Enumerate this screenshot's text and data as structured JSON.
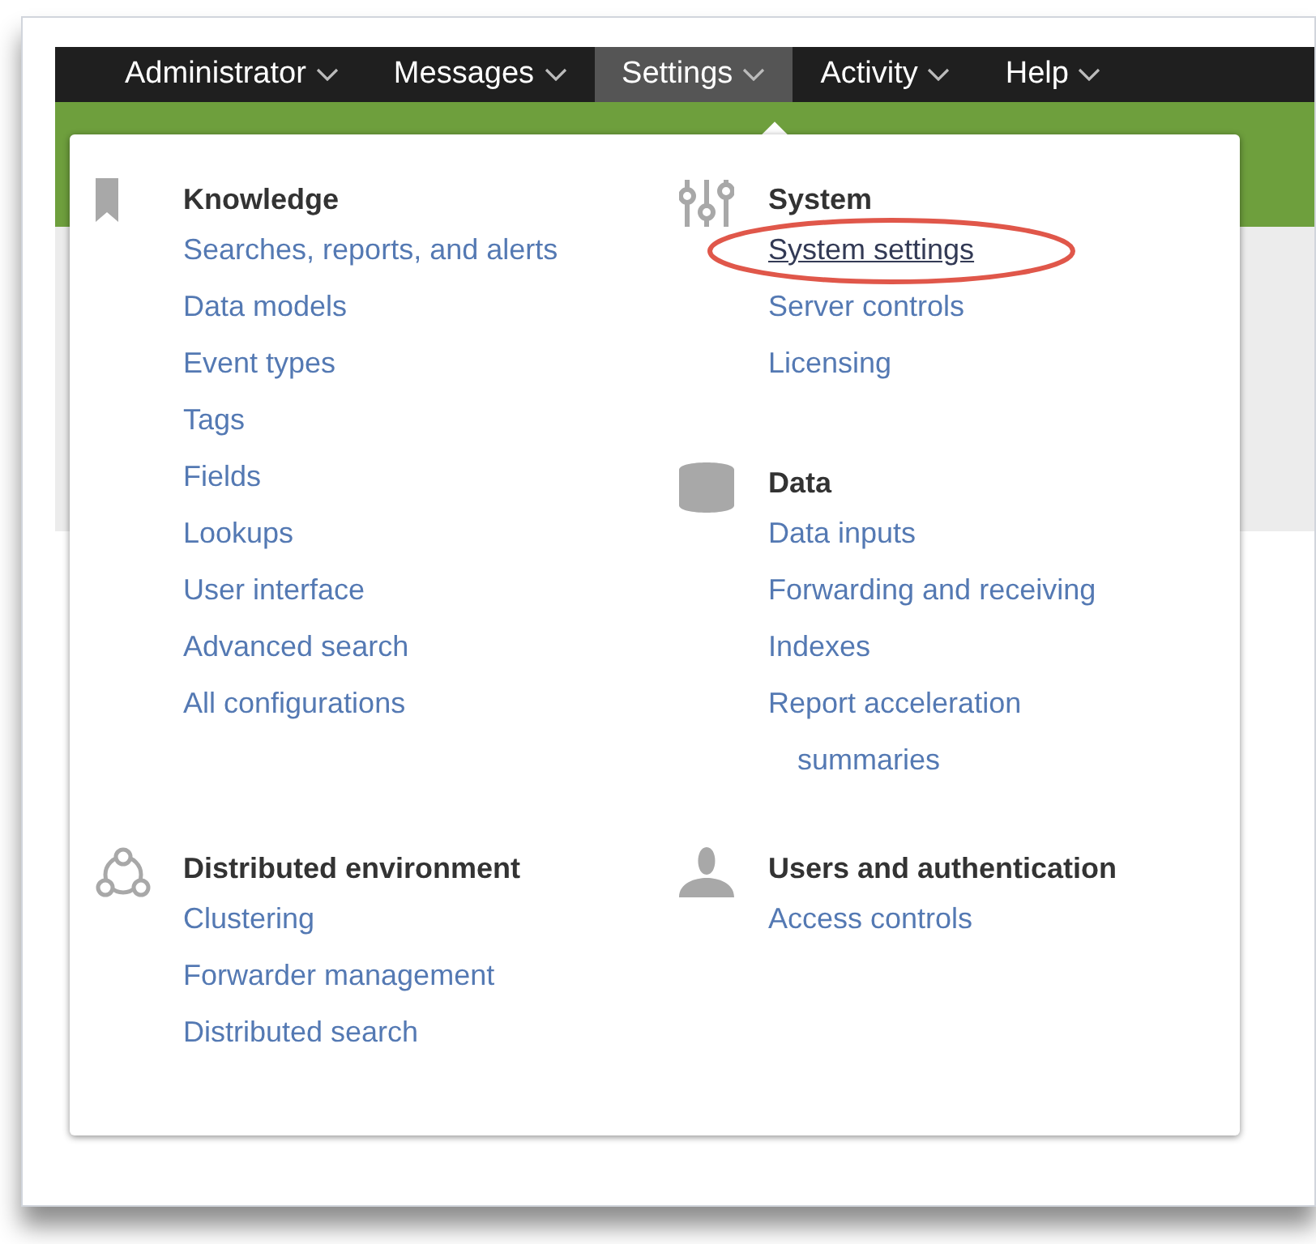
{
  "nav": {
    "items": [
      {
        "label": "Administrator",
        "selected": false
      },
      {
        "label": "Messages",
        "selected": false
      },
      {
        "label": "Settings",
        "selected": true
      },
      {
        "label": "Activity",
        "selected": false
      },
      {
        "label": "Help",
        "selected": false
      }
    ]
  },
  "menu": {
    "rows": [
      {
        "cells": [
          {
            "sections": [
              {
                "kind": "bookmark",
                "heading": "Knowledge",
                "items": [
                  {
                    "label": "Searches, reports, and alerts",
                    "highlighted": false
                  },
                  {
                    "label": "Data models",
                    "highlighted": false
                  },
                  {
                    "label": "Event types",
                    "highlighted": false
                  },
                  {
                    "label": "Tags",
                    "highlighted": false
                  },
                  {
                    "label": "Fields",
                    "highlighted": false
                  },
                  {
                    "label": "Lookups",
                    "highlighted": false
                  },
                  {
                    "label": "User interface",
                    "highlighted": false
                  },
                  {
                    "label": "Advanced search",
                    "highlighted": false
                  },
                  {
                    "label": "All configurations",
                    "highlighted": false
                  }
                ]
              }
            ]
          },
          {
            "sections": [
              {
                "kind": "sliders",
                "heading": "System",
                "items": [
                  {
                    "label": "System settings",
                    "highlighted": true
                  },
                  {
                    "label": "Server controls",
                    "highlighted": false
                  },
                  {
                    "label": "Licensing",
                    "highlighted": false
                  }
                ]
              },
              {
                "kind": "database",
                "heading": "Data",
                "items": [
                  {
                    "label": "Data inputs",
                    "highlighted": false
                  },
                  {
                    "label": "Forwarding and receiving",
                    "highlighted": false
                  },
                  {
                    "label": "Indexes",
                    "highlighted": false
                  },
                  {
                    "label": "Report acceleration summaries",
                    "highlighted": false
                  }
                ]
              }
            ]
          }
        ]
      },
      {
        "cells": [
          {
            "sections": [
              {
                "kind": "network",
                "heading": "Distributed environment",
                "items": [
                  {
                    "label": "Clustering",
                    "highlighted": false
                  },
                  {
                    "label": "Forwarder management",
                    "highlighted": false
                  },
                  {
                    "label": "Distributed search",
                    "highlighted": false
                  }
                ]
              }
            ]
          },
          {
            "sections": [
              {
                "kind": "person",
                "heading": "Users and authentication",
                "items": [
                  {
                    "label": "Access controls",
                    "highlighted": false
                  }
                ]
              }
            ]
          }
        ]
      }
    ]
  }
}
